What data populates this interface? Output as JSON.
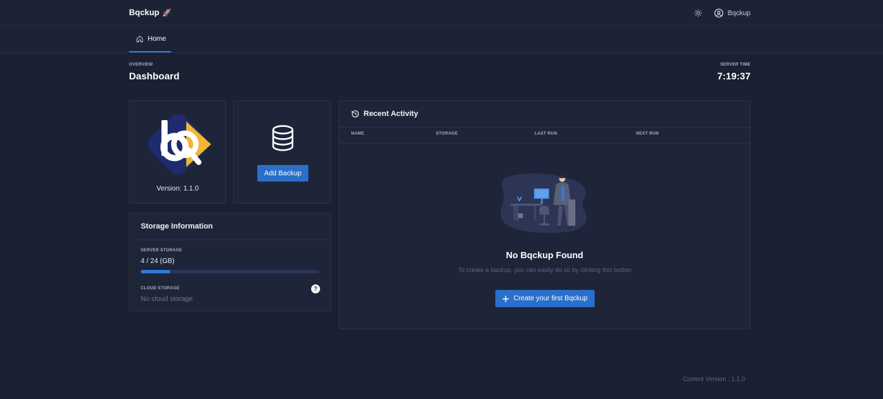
{
  "app": {
    "brand": "Bqckup",
    "brand_emoji": "🚀",
    "user_name": "Bqckup"
  },
  "nav": {
    "home_label": "Home"
  },
  "header": {
    "eyebrow": "OVERVIEW",
    "title": "Dashboard",
    "server_time_label": "SERVER TIME",
    "server_time": "7:19:37"
  },
  "logo_card": {
    "version": "Version: 1.1.0"
  },
  "add_card": {
    "button_label": "Add Backup"
  },
  "storage": {
    "title": "Storage Information",
    "server_label": "SERVER STORAGE",
    "server_value": "4 / 24 (GB)",
    "server_used_fraction": 0.1667,
    "cloud_label": "CLOUD STORAGE",
    "cloud_value": "No cloud storage",
    "help_glyph": "?"
  },
  "activity": {
    "title": "Recent Activity",
    "columns": [
      "NAME",
      "STORAGE",
      "LAST RUN",
      "NEXT RUN"
    ],
    "empty_title": "No Bqckup Found",
    "empty_subtitle": "To create a backup, you can easily do so by clicking this button",
    "create_button": "Create your first Bqckup"
  },
  "footer": {
    "current_version": "Current Version : 1.1.0"
  },
  "colors": {
    "background": "#1b2032",
    "card": "#1e2538",
    "accent": "#2a6fc9",
    "logo_navy": "#1f2b6e",
    "logo_yellow": "#f2b632"
  },
  "icons": {
    "theme": "sun-icon",
    "user": "user-circle-icon",
    "home": "home-icon",
    "database": "database-icon",
    "history": "history-icon",
    "plus": "plus-icon",
    "help": "question-icon"
  }
}
